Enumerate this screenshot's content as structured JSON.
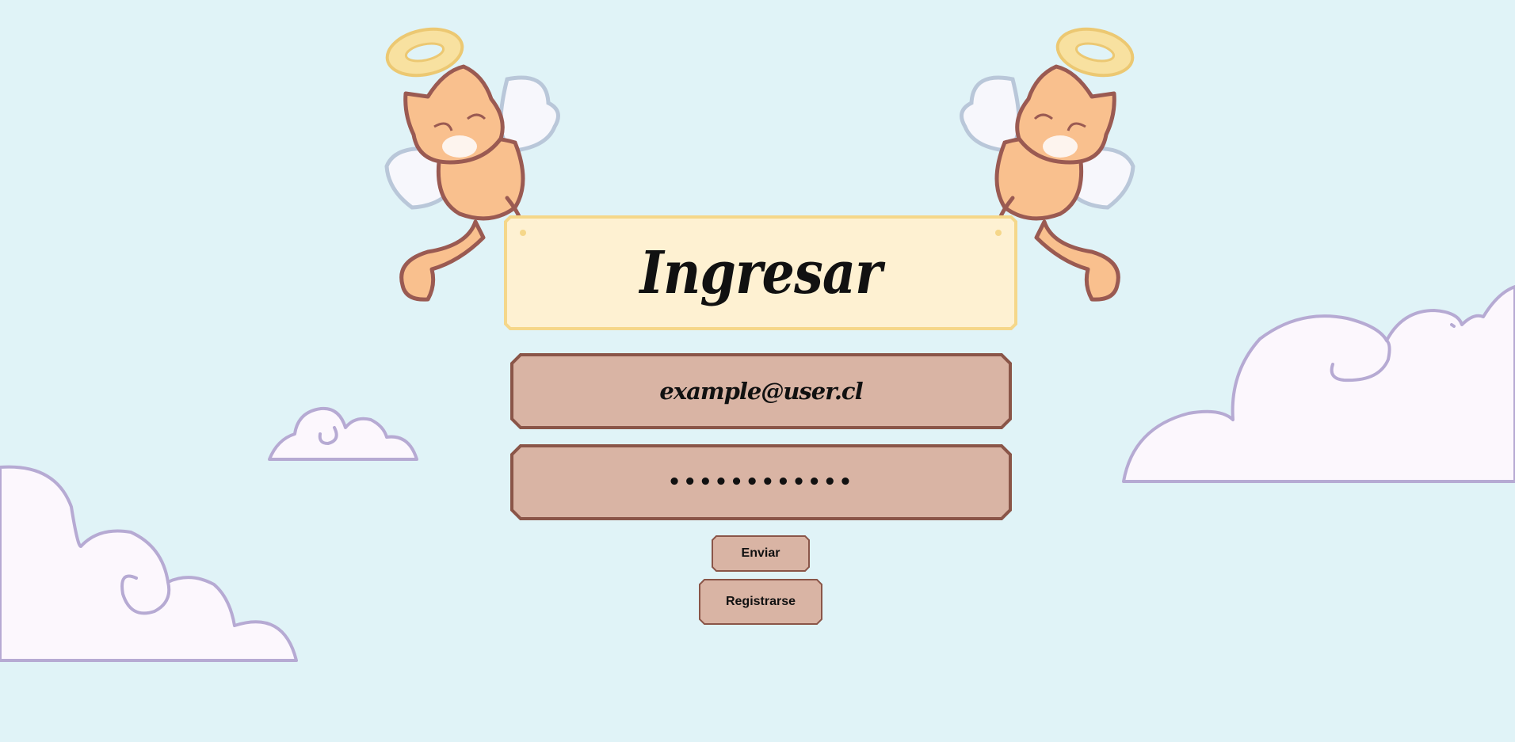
{
  "login": {
    "title": "Ingresar",
    "email_placeholder": "example@user.cl",
    "password_value": "••••••••••••",
    "submit_label": "Enviar",
    "register_label": "Registrarse"
  },
  "colors": {
    "background": "#e0f3f7",
    "sign_fill": "#fef1d2",
    "sign_border": "#f5d78a",
    "field_fill": "#d9b4a4",
    "field_border": "#8a5548",
    "cloud_fill": "#fcf7fd",
    "cloud_stroke": "#b6aad3"
  },
  "decor": {
    "cat_left": "angel-cat-icon",
    "cat_right": "angel-cat-icon",
    "clouds": "cloud-icon"
  }
}
